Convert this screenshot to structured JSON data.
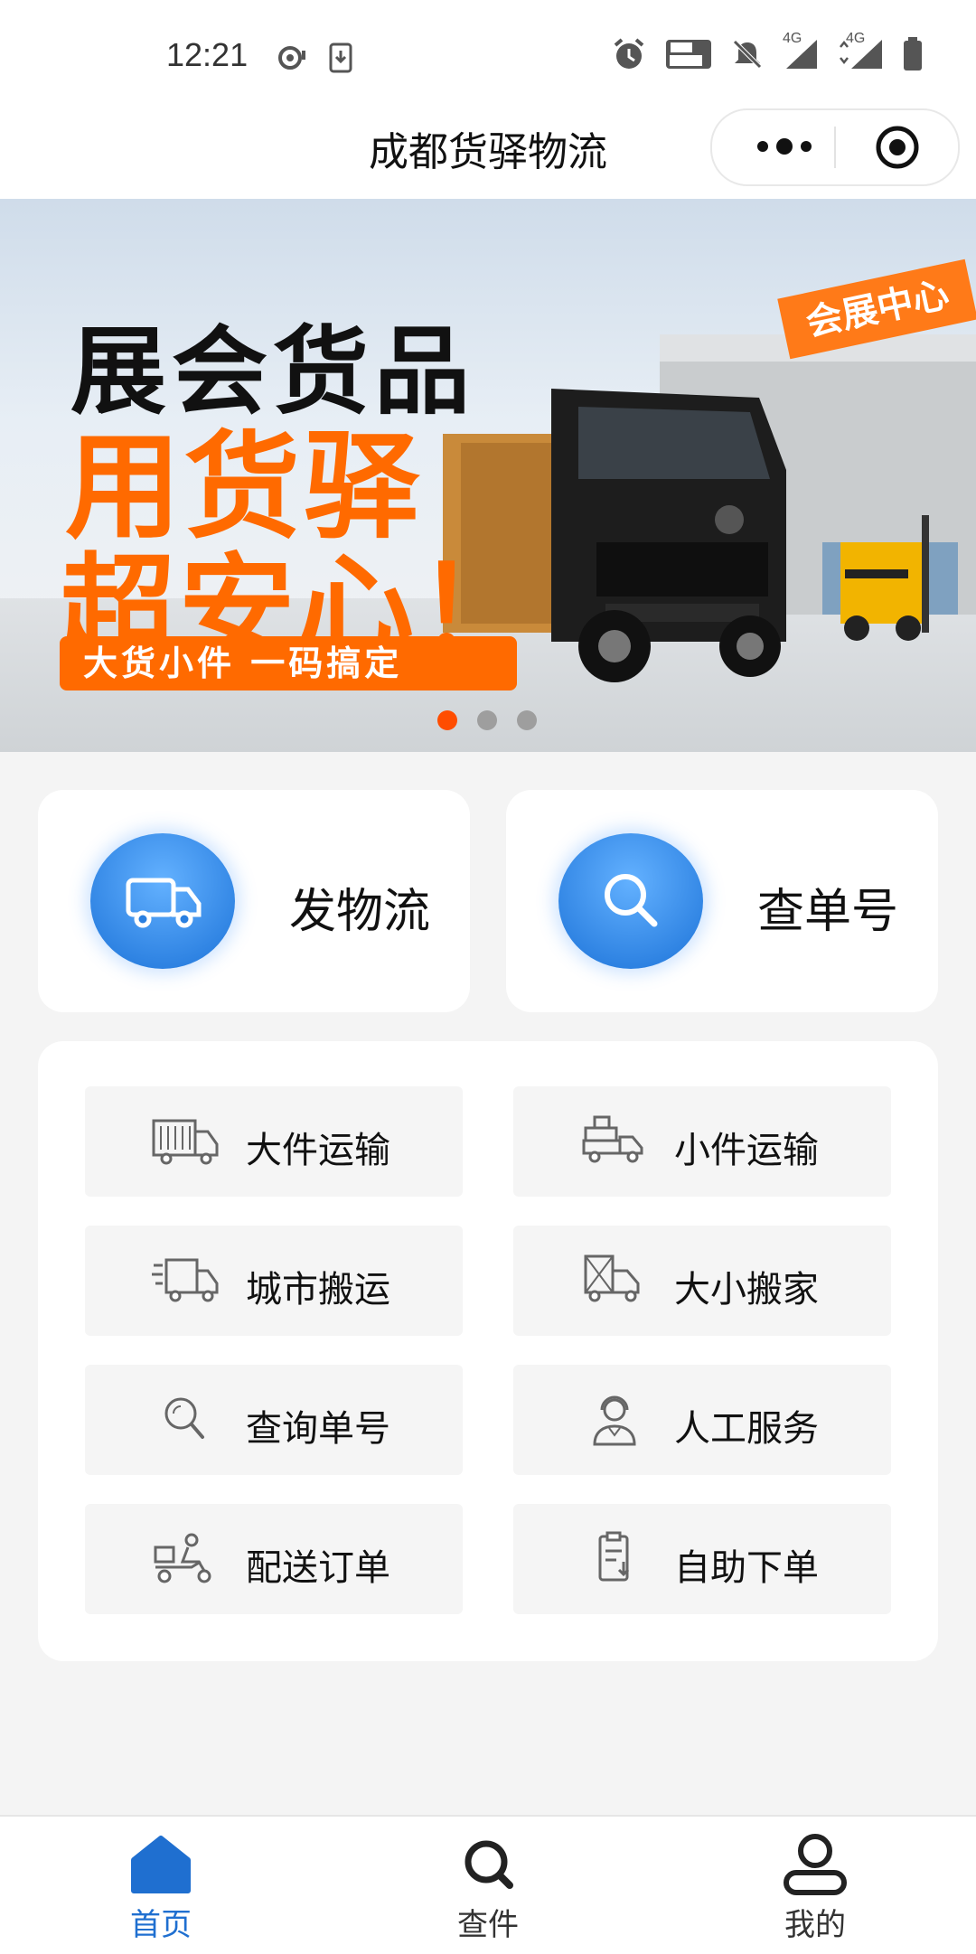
{
  "status_bar": {
    "time": "12:21",
    "left_icons": [
      "data-saver-icon",
      "download-icon"
    ],
    "right_icons": [
      "alarm-icon",
      "volte-icon",
      "mute-icon",
      "signal-4g-icon",
      "signal-4g-data-icon",
      "battery-icon"
    ],
    "signal_label_1": "4G",
    "signal_label_2": "4G"
  },
  "nav": {
    "title": "成都货驿物流",
    "more_icon": "more-icon",
    "target_icon": "target-icon"
  },
  "banner": {
    "line1": "展会货品",
    "line2": "用货驿",
    "line3": "超安心！",
    "pill": "大货小件 一码搞定",
    "badge": "会展中心",
    "page_count": 3,
    "active_page": 1,
    "accent": "#ff6a00"
  },
  "actions": [
    {
      "label": "发物流",
      "icon": "truck-icon"
    },
    {
      "label": "查单号",
      "icon": "search-icon"
    }
  ],
  "services": [
    {
      "label": "大件运输",
      "icon": "large-cargo-truck-icon"
    },
    {
      "label": "小件运输",
      "icon": "small-parcel-truck-icon"
    },
    {
      "label": "城市搬运",
      "icon": "city-delivery-truck-icon"
    },
    {
      "label": "大小搬家",
      "icon": "moving-truck-icon"
    },
    {
      "label": "查询单号",
      "icon": "search-icon"
    },
    {
      "label": "人工服务",
      "icon": "customer-service-icon"
    },
    {
      "label": "配送订单",
      "icon": "courier-scooter-icon"
    },
    {
      "label": "自助下单",
      "icon": "clipboard-order-icon"
    }
  ],
  "tabs": [
    {
      "label": "首页",
      "icon": "home-icon",
      "active": true
    },
    {
      "label": "查件",
      "icon": "search-icon",
      "active": false
    },
    {
      "label": "我的",
      "icon": "user-icon",
      "active": false
    }
  ],
  "colors": {
    "primary": "#1f6fd0",
    "banner_orange": "#ff6a00",
    "active_dot": "#ff4d00"
  }
}
